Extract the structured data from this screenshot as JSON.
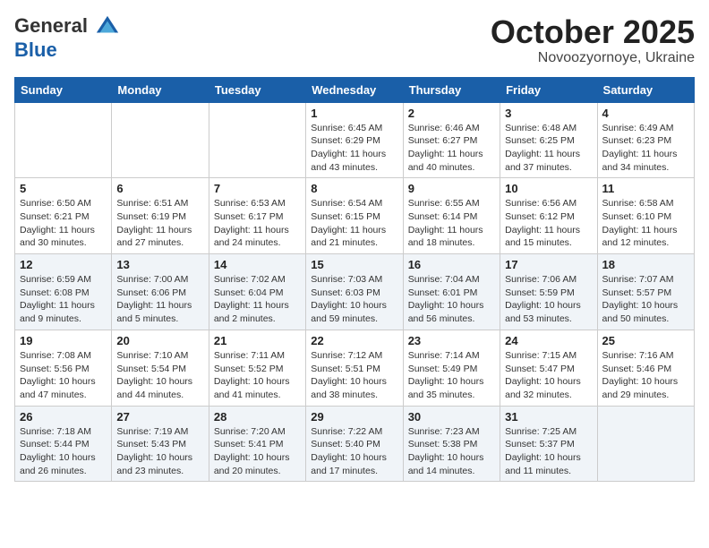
{
  "header": {
    "logo_line1": "General",
    "logo_line2": "Blue",
    "month": "October 2025",
    "location": "Novoozyornoye, Ukraine"
  },
  "weekdays": [
    "Sunday",
    "Monday",
    "Tuesday",
    "Wednesday",
    "Thursday",
    "Friday",
    "Saturday"
  ],
  "weeks": [
    [
      {
        "day": "",
        "info": ""
      },
      {
        "day": "",
        "info": ""
      },
      {
        "day": "",
        "info": ""
      },
      {
        "day": "1",
        "info": "Sunrise: 6:45 AM\nSunset: 6:29 PM\nDaylight: 11 hours\nand 43 minutes."
      },
      {
        "day": "2",
        "info": "Sunrise: 6:46 AM\nSunset: 6:27 PM\nDaylight: 11 hours\nand 40 minutes."
      },
      {
        "day": "3",
        "info": "Sunrise: 6:48 AM\nSunset: 6:25 PM\nDaylight: 11 hours\nand 37 minutes."
      },
      {
        "day": "4",
        "info": "Sunrise: 6:49 AM\nSunset: 6:23 PM\nDaylight: 11 hours\nand 34 minutes."
      }
    ],
    [
      {
        "day": "5",
        "info": "Sunrise: 6:50 AM\nSunset: 6:21 PM\nDaylight: 11 hours\nand 30 minutes."
      },
      {
        "day": "6",
        "info": "Sunrise: 6:51 AM\nSunset: 6:19 PM\nDaylight: 11 hours\nand 27 minutes."
      },
      {
        "day": "7",
        "info": "Sunrise: 6:53 AM\nSunset: 6:17 PM\nDaylight: 11 hours\nand 24 minutes."
      },
      {
        "day": "8",
        "info": "Sunrise: 6:54 AM\nSunset: 6:15 PM\nDaylight: 11 hours\nand 21 minutes."
      },
      {
        "day": "9",
        "info": "Sunrise: 6:55 AM\nSunset: 6:14 PM\nDaylight: 11 hours\nand 18 minutes."
      },
      {
        "day": "10",
        "info": "Sunrise: 6:56 AM\nSunset: 6:12 PM\nDaylight: 11 hours\nand 15 minutes."
      },
      {
        "day": "11",
        "info": "Sunrise: 6:58 AM\nSunset: 6:10 PM\nDaylight: 11 hours\nand 12 minutes."
      }
    ],
    [
      {
        "day": "12",
        "info": "Sunrise: 6:59 AM\nSunset: 6:08 PM\nDaylight: 11 hours\nand 9 minutes."
      },
      {
        "day": "13",
        "info": "Sunrise: 7:00 AM\nSunset: 6:06 PM\nDaylight: 11 hours\nand 5 minutes."
      },
      {
        "day": "14",
        "info": "Sunrise: 7:02 AM\nSunset: 6:04 PM\nDaylight: 11 hours\nand 2 minutes."
      },
      {
        "day": "15",
        "info": "Sunrise: 7:03 AM\nSunset: 6:03 PM\nDaylight: 10 hours\nand 59 minutes."
      },
      {
        "day": "16",
        "info": "Sunrise: 7:04 AM\nSunset: 6:01 PM\nDaylight: 10 hours\nand 56 minutes."
      },
      {
        "day": "17",
        "info": "Sunrise: 7:06 AM\nSunset: 5:59 PM\nDaylight: 10 hours\nand 53 minutes."
      },
      {
        "day": "18",
        "info": "Sunrise: 7:07 AM\nSunset: 5:57 PM\nDaylight: 10 hours\nand 50 minutes."
      }
    ],
    [
      {
        "day": "19",
        "info": "Sunrise: 7:08 AM\nSunset: 5:56 PM\nDaylight: 10 hours\nand 47 minutes."
      },
      {
        "day": "20",
        "info": "Sunrise: 7:10 AM\nSunset: 5:54 PM\nDaylight: 10 hours\nand 44 minutes."
      },
      {
        "day": "21",
        "info": "Sunrise: 7:11 AM\nSunset: 5:52 PM\nDaylight: 10 hours\nand 41 minutes."
      },
      {
        "day": "22",
        "info": "Sunrise: 7:12 AM\nSunset: 5:51 PM\nDaylight: 10 hours\nand 38 minutes."
      },
      {
        "day": "23",
        "info": "Sunrise: 7:14 AM\nSunset: 5:49 PM\nDaylight: 10 hours\nand 35 minutes."
      },
      {
        "day": "24",
        "info": "Sunrise: 7:15 AM\nSunset: 5:47 PM\nDaylight: 10 hours\nand 32 minutes."
      },
      {
        "day": "25",
        "info": "Sunrise: 7:16 AM\nSunset: 5:46 PM\nDaylight: 10 hours\nand 29 minutes."
      }
    ],
    [
      {
        "day": "26",
        "info": "Sunrise: 7:18 AM\nSunset: 5:44 PM\nDaylight: 10 hours\nand 26 minutes."
      },
      {
        "day": "27",
        "info": "Sunrise: 7:19 AM\nSunset: 5:43 PM\nDaylight: 10 hours\nand 23 minutes."
      },
      {
        "day": "28",
        "info": "Sunrise: 7:20 AM\nSunset: 5:41 PM\nDaylight: 10 hours\nand 20 minutes."
      },
      {
        "day": "29",
        "info": "Sunrise: 7:22 AM\nSunset: 5:40 PM\nDaylight: 10 hours\nand 17 minutes."
      },
      {
        "day": "30",
        "info": "Sunrise: 7:23 AM\nSunset: 5:38 PM\nDaylight: 10 hours\nand 14 minutes."
      },
      {
        "day": "31",
        "info": "Sunrise: 7:25 AM\nSunset: 5:37 PM\nDaylight: 10 hours\nand 11 minutes."
      },
      {
        "day": "",
        "info": ""
      }
    ]
  ]
}
